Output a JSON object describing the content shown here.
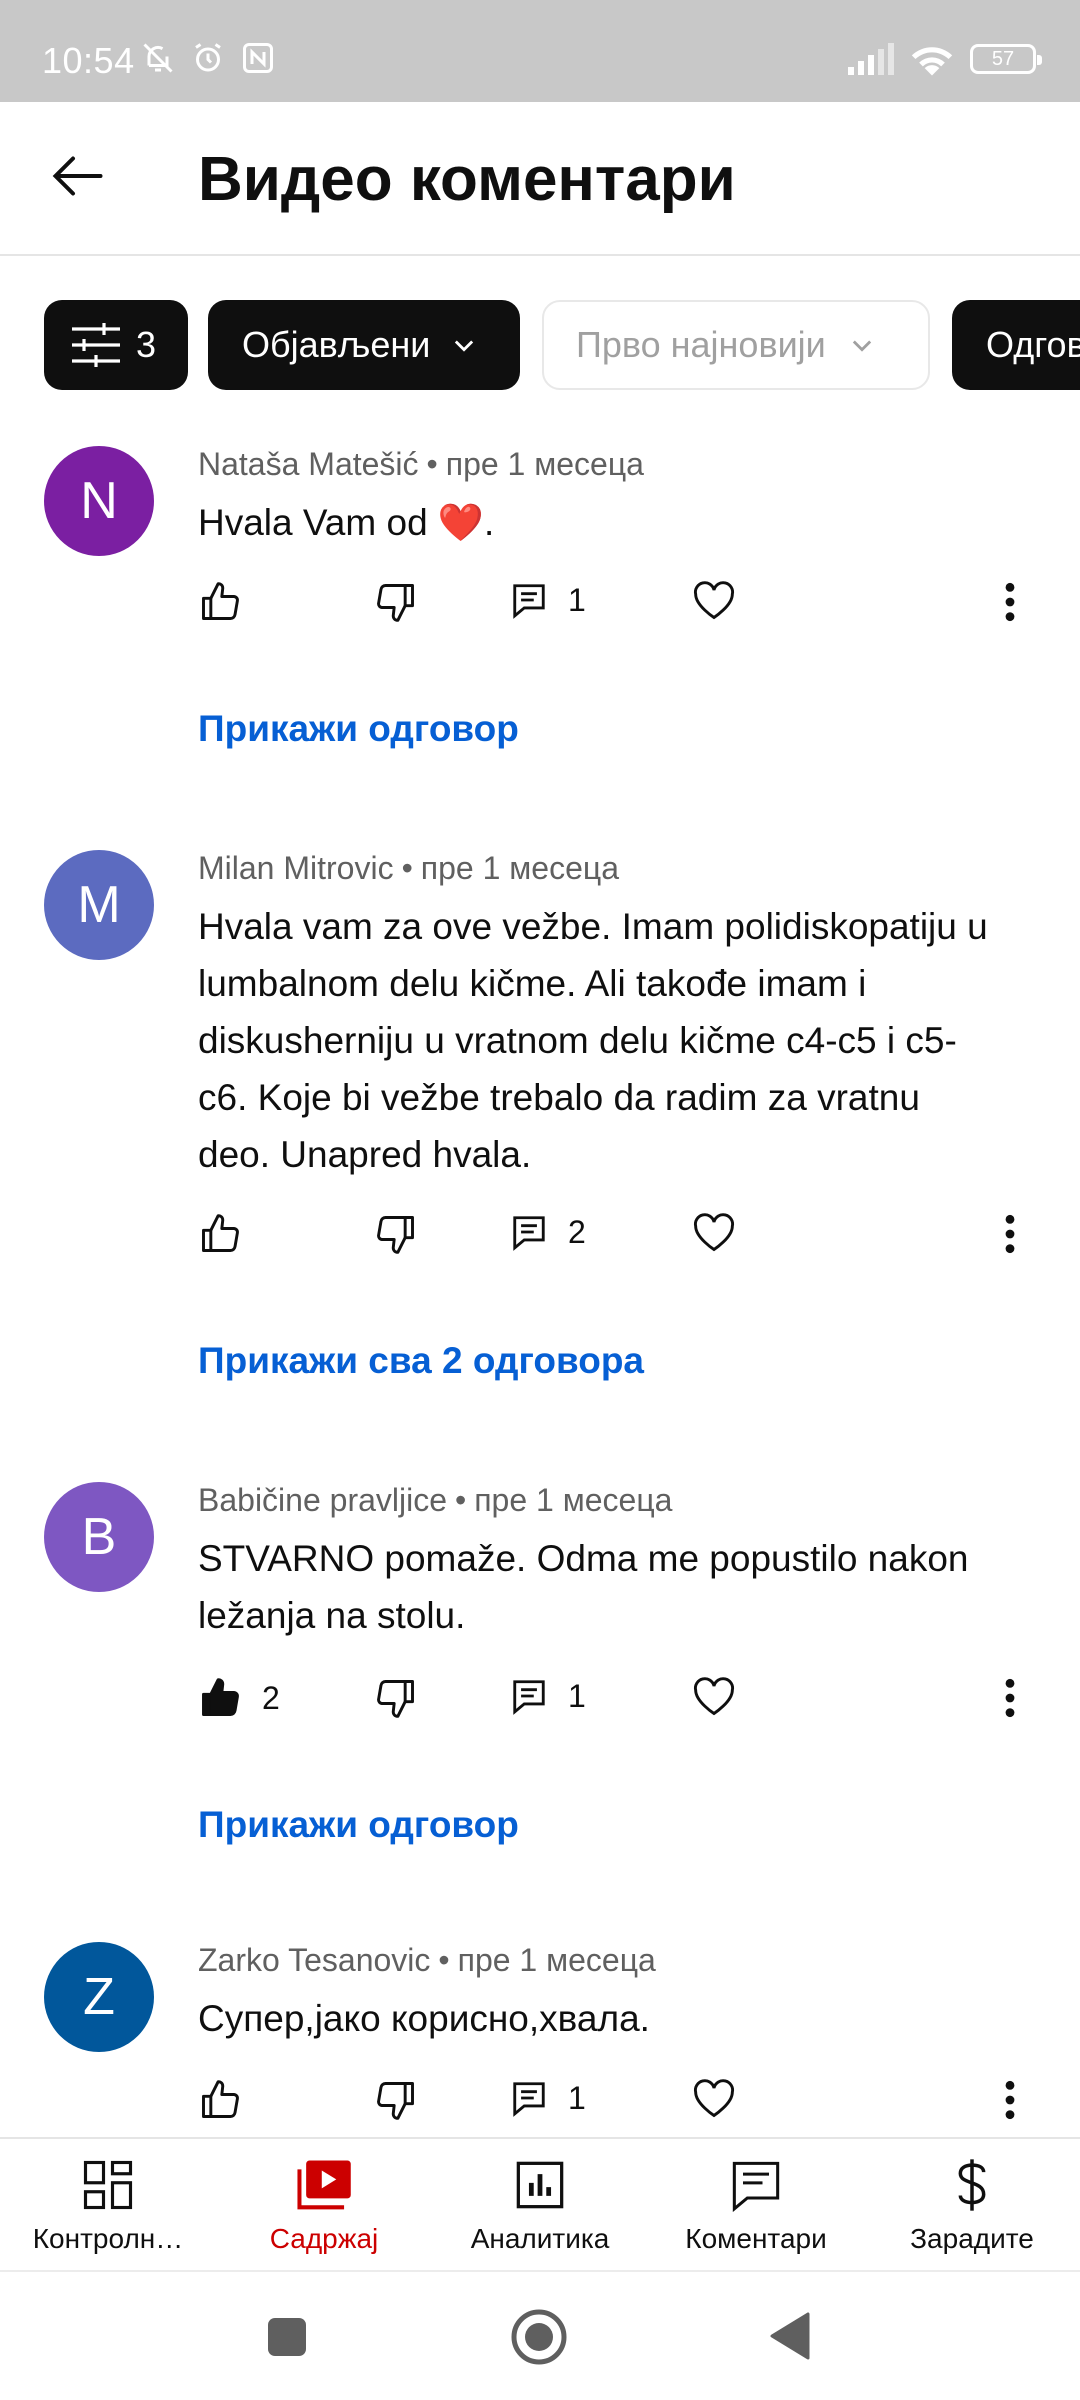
{
  "status_bar": {
    "time": "10:54",
    "battery": "57"
  },
  "header": {
    "title": "Видео коментари"
  },
  "filters": {
    "filter_count": "3",
    "published": "Објављени",
    "sort": "Прво најновији",
    "replies": "Одговори"
  },
  "comments": [
    {
      "avatar_letter": "N",
      "avatar_color": "#7b1fa2",
      "author": "Nataša Matešić",
      "time": "пре 1 месеца",
      "text": "Hvala Vam od ❤️.",
      "likes": "",
      "replies_count": "1",
      "replies_link": "Прикажи одговор"
    },
    {
      "avatar_letter": "M",
      "avatar_color": "#5c6bc0",
      "author": "Milan Mitrovic",
      "time": "пре 1 месеца",
      "text": "Hvala vam za ove vežbe. Imam polidiskopatiju u lumbalnom delu kičme. Ali takođe imam i diskusherniju u vratnom delu kičme c4-c5 i c5-c6. Koje bi vežbe trebalo da radim za vratnu deo. Unapred hvala.",
      "likes": "",
      "replies_count": "2",
      "replies_link": "Прикажи сва 2 одговора"
    },
    {
      "avatar_letter": "B",
      "avatar_color": "#7e57c2",
      "author": "Babičine pravljice",
      "time": "пре 1 месеца",
      "text": "STVARNO pomaže. Odma me popustilo nakon ležanja na stolu.",
      "likes": "2",
      "replies_count": "1",
      "replies_link": "Прикажи одговор"
    },
    {
      "avatar_letter": "Z",
      "avatar_color": "#01579b",
      "author": "Zarko Tesanovic",
      "time": "пре 1 месеца",
      "text": "Супер,јако корисно,хвала.",
      "likes": "",
      "replies_count": "1",
      "replies_link": ""
    }
  ],
  "bottom_nav": [
    {
      "label": "Контролн…",
      "icon": "dashboard-icon"
    },
    {
      "label": "Садржај",
      "icon": "content-icon",
      "active": true
    },
    {
      "label": "Аналитика",
      "icon": "analytics-icon"
    },
    {
      "label": "Коментари",
      "icon": "comments-icon"
    },
    {
      "label": "Зарадите",
      "icon": "earn-icon"
    }
  ],
  "colors": {
    "accent_red": "#cc0000",
    "link_blue": "#065fd4",
    "status_bar": "#c8c8c8"
  }
}
